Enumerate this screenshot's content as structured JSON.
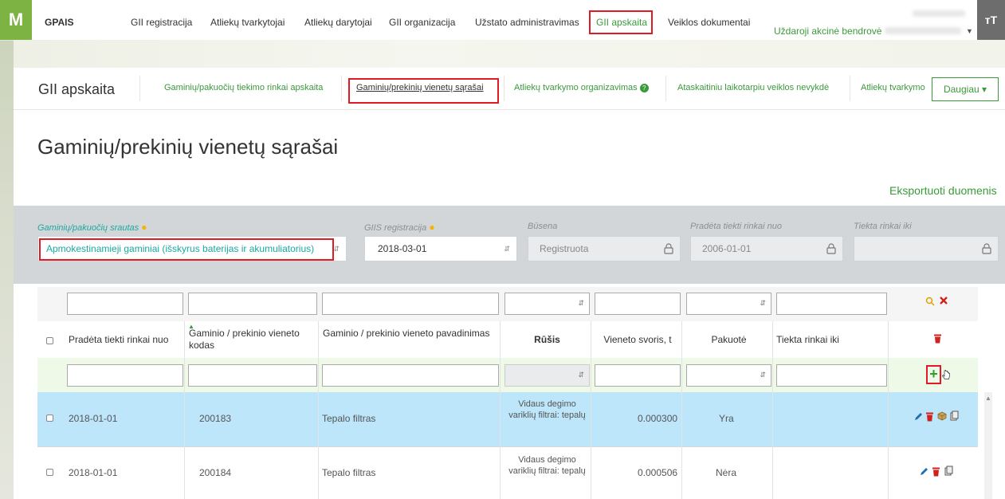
{
  "topnav": {
    "logo": "M",
    "brand": "GPAIS",
    "items": [
      "GII registracija",
      "Atliekų tvarkytojai",
      "Atliekų darytojai",
      "GII organizacija",
      "Užstato administravimas",
      "GII apskaita",
      "Veiklos dokumentai"
    ],
    "company": "Uždaroji akcinė bendrovė",
    "profile_icon": "font-size-icon"
  },
  "subnav": {
    "title": "GII apskaita",
    "items": [
      "Gaminių/pakuočių tiekimo rinkai apskaita",
      "Gaminių/prekinių vienetų sąrašai",
      "Atliekų tvarkymo organizavimas",
      "Ataskaitiniu laikotarpiu veiklos nevykdė",
      "Atliekų tvarkymo"
    ],
    "more": "Daugiau"
  },
  "page": {
    "title": "Gaminių/prekinių vienetų sąrašai",
    "export": "Eksportuoti duomenis"
  },
  "filters": {
    "stream_label": "Gaminių/pakuočių srautas",
    "stream_value": "Apmokestinamieji gaminiai (išskyrus baterijas ir akumuliatorius)",
    "giis_label": "GIIS registracija",
    "giis_value": "2018-03-01",
    "status_label": "Būsena",
    "status_value": "Registruota",
    "start_label": "Pradėta tiekti rinkai nuo",
    "start_value": "2006-01-01",
    "end_label": "Tiekta rinkai iki",
    "end_value": ""
  },
  "table": {
    "headers": [
      "Pradėta tiekti rinkai nuo",
      "Gaminio / prekinio vieneto kodas",
      "Gaminio / prekinio vieneto pavadinimas",
      "Rūšis",
      "Vieneto svoris, t",
      "Pakuotė",
      "Tiekta rinkai iki"
    ],
    "rows": [
      {
        "start": "2018-01-01",
        "code": "200183",
        "name": "Tepalo filtras",
        "type": "Vidaus degimo variklių filtrai: tepalų",
        "weight": "0.000300",
        "package": "Yra",
        "end": ""
      },
      {
        "start": "2018-01-01",
        "code": "200184",
        "name": "Tepalo filtras",
        "type": "Vidaus degimo variklių filtrai: tepalų",
        "weight": "0.000506",
        "package": "Nėra",
        "end": ""
      }
    ]
  },
  "colors": {
    "accent_green": "#3a9a3a",
    "teal": "#19a9a0",
    "highlight_red": "#e01b24",
    "selected_row": "#bde6fb"
  }
}
